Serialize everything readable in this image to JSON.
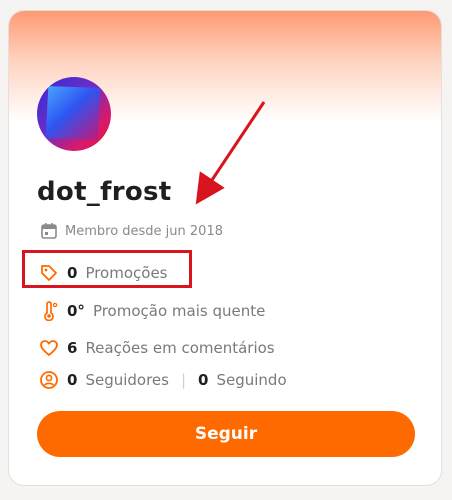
{
  "profile": {
    "username": "dot_frost",
    "member_since": "Membro desde jun 2018"
  },
  "stats": {
    "promotions_count": "0",
    "promotions_label": "Promoções",
    "hottest_count": "0°",
    "hottest_label": "Promoção mais quente",
    "reactions_count": "6",
    "reactions_label": "Reações em comentários",
    "followers_count": "0",
    "followers_label": "Seguidores",
    "following_count": "0",
    "following_label": "Seguindo"
  },
  "actions": {
    "follow_label": "Seguir"
  },
  "colors": {
    "accent": "#ff6a00",
    "annotation": "#d8141f"
  },
  "icons": {
    "calendar": "calendar-icon",
    "tag": "tag-icon",
    "thermometer": "thermometer-icon",
    "heart": "heart-icon",
    "user": "user-circle-icon"
  }
}
